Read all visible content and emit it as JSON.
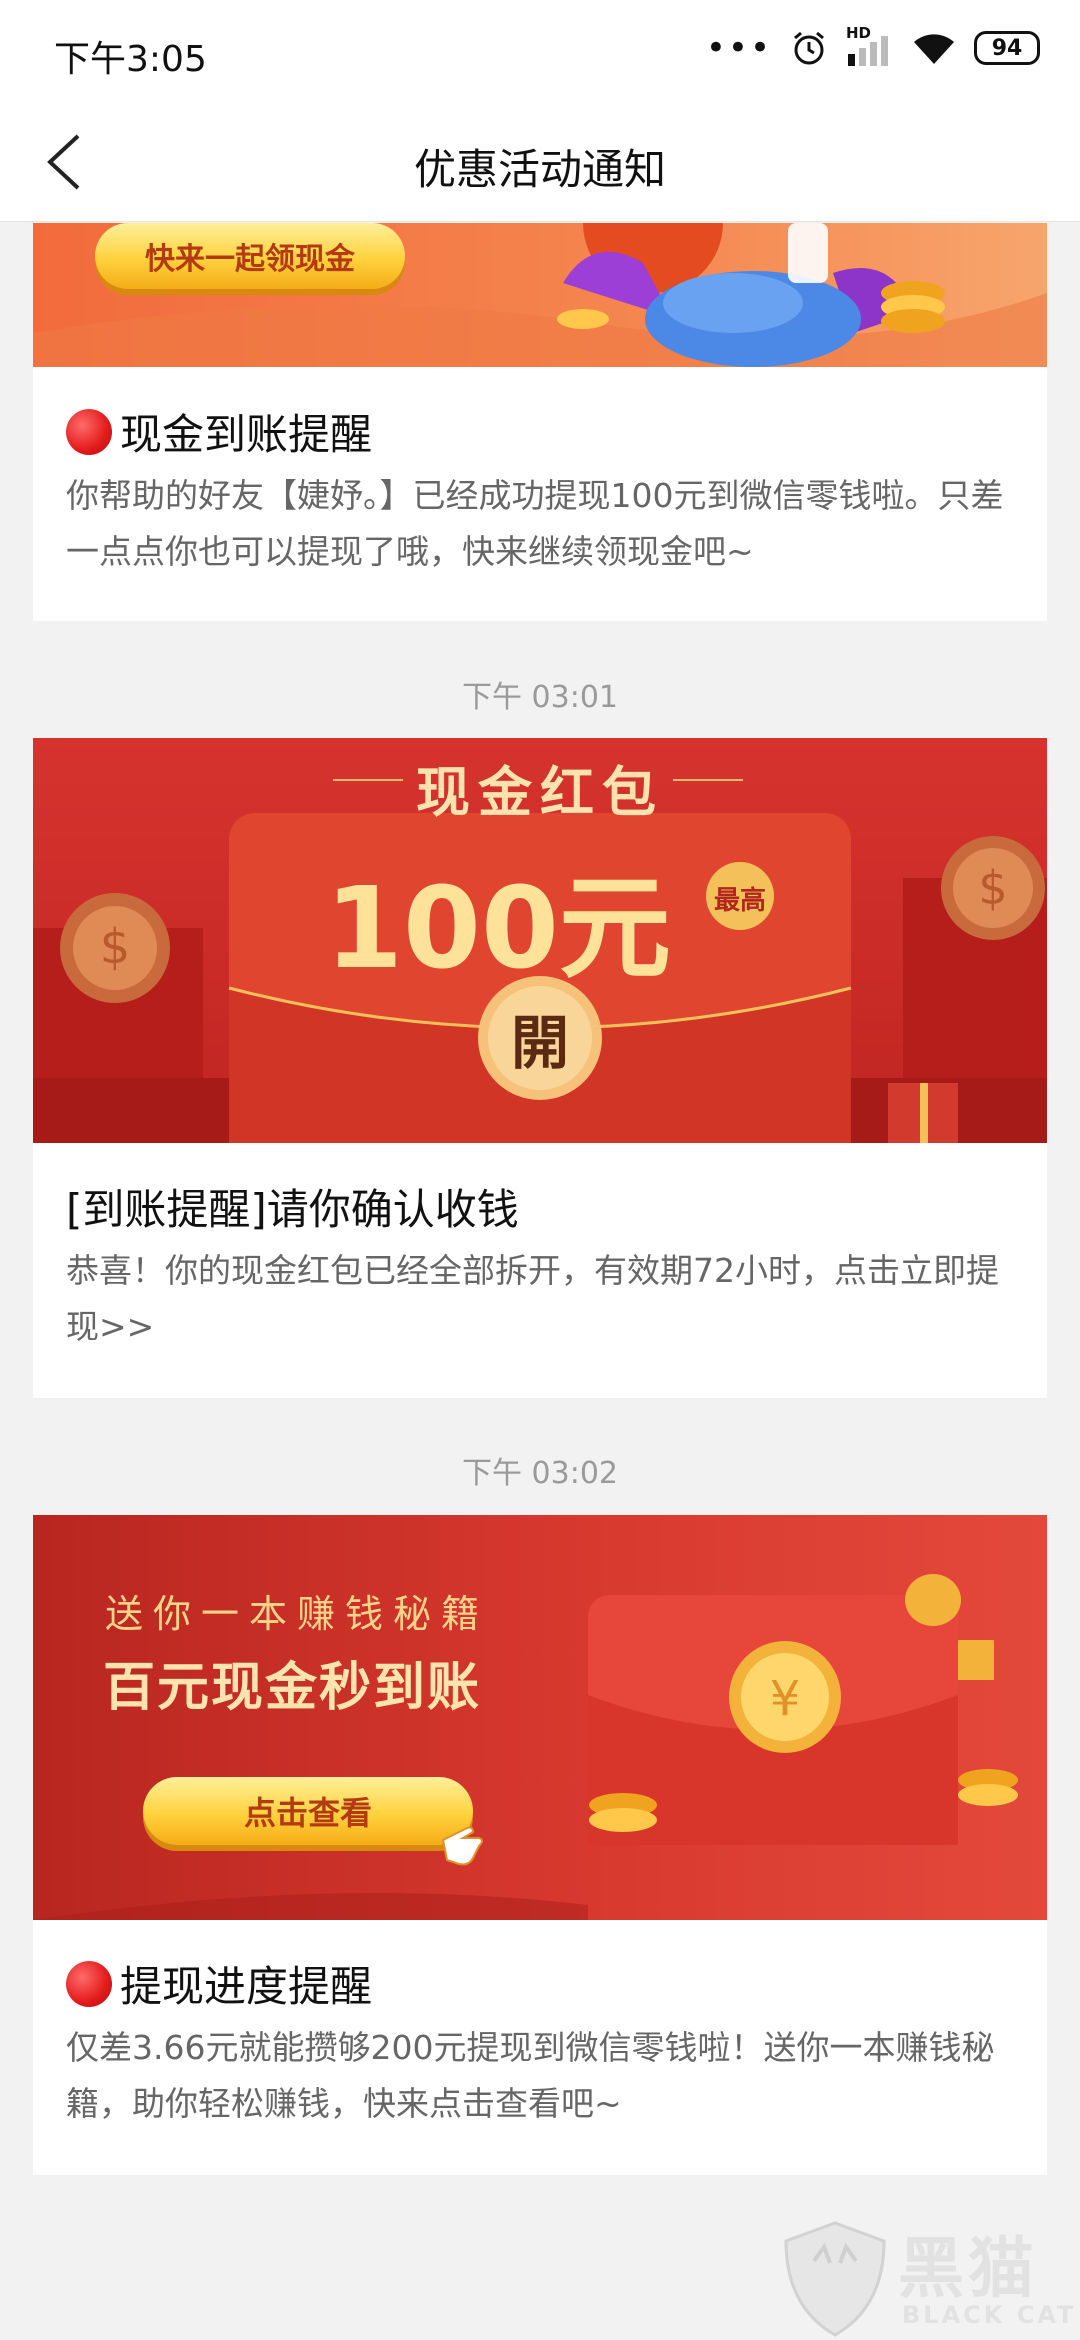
{
  "status_bar": {
    "time": "下午3:05",
    "network_badge": "HD",
    "battery": "94"
  },
  "header": {
    "title": "优惠活动通知"
  },
  "messages": [
    {
      "banner_button": "快来一起领现金",
      "title": "现金到账提醒",
      "body": "你帮助的好友【婕妤。】已经成功提现100元到微信零钱啦。只差一点点你也可以提现了哦，快来继续领现金吧~"
    },
    {
      "timestamp": "下午 03:01",
      "banner_heading": "现金红包",
      "banner_amount": "100元",
      "banner_badge": "最高",
      "banner_open": "開",
      "title": "[到账提醒]请你确认收钱",
      "body": "恭喜！你的现金红包已经全部拆开，有效期72小时，点击立即提现>>"
    },
    {
      "timestamp": "下午 03:02",
      "banner_line1": "送你一本赚钱秘籍",
      "banner_line2": "百元现金秒到账",
      "banner_button": "点击查看",
      "title": "提现进度提醒",
      "body": "仅差3.66元就能攒够200元提现到微信零钱啦！送你一本赚钱秘籍，助你轻松赚钱，快来点击查看吧~"
    }
  ],
  "watermark": {
    "name": "黑猫",
    "subtitle": "BLACK CAT"
  },
  "colors": {
    "accent_red": "#d9312b",
    "gold": "#ffd23d",
    "background": "#f2f2f2"
  }
}
